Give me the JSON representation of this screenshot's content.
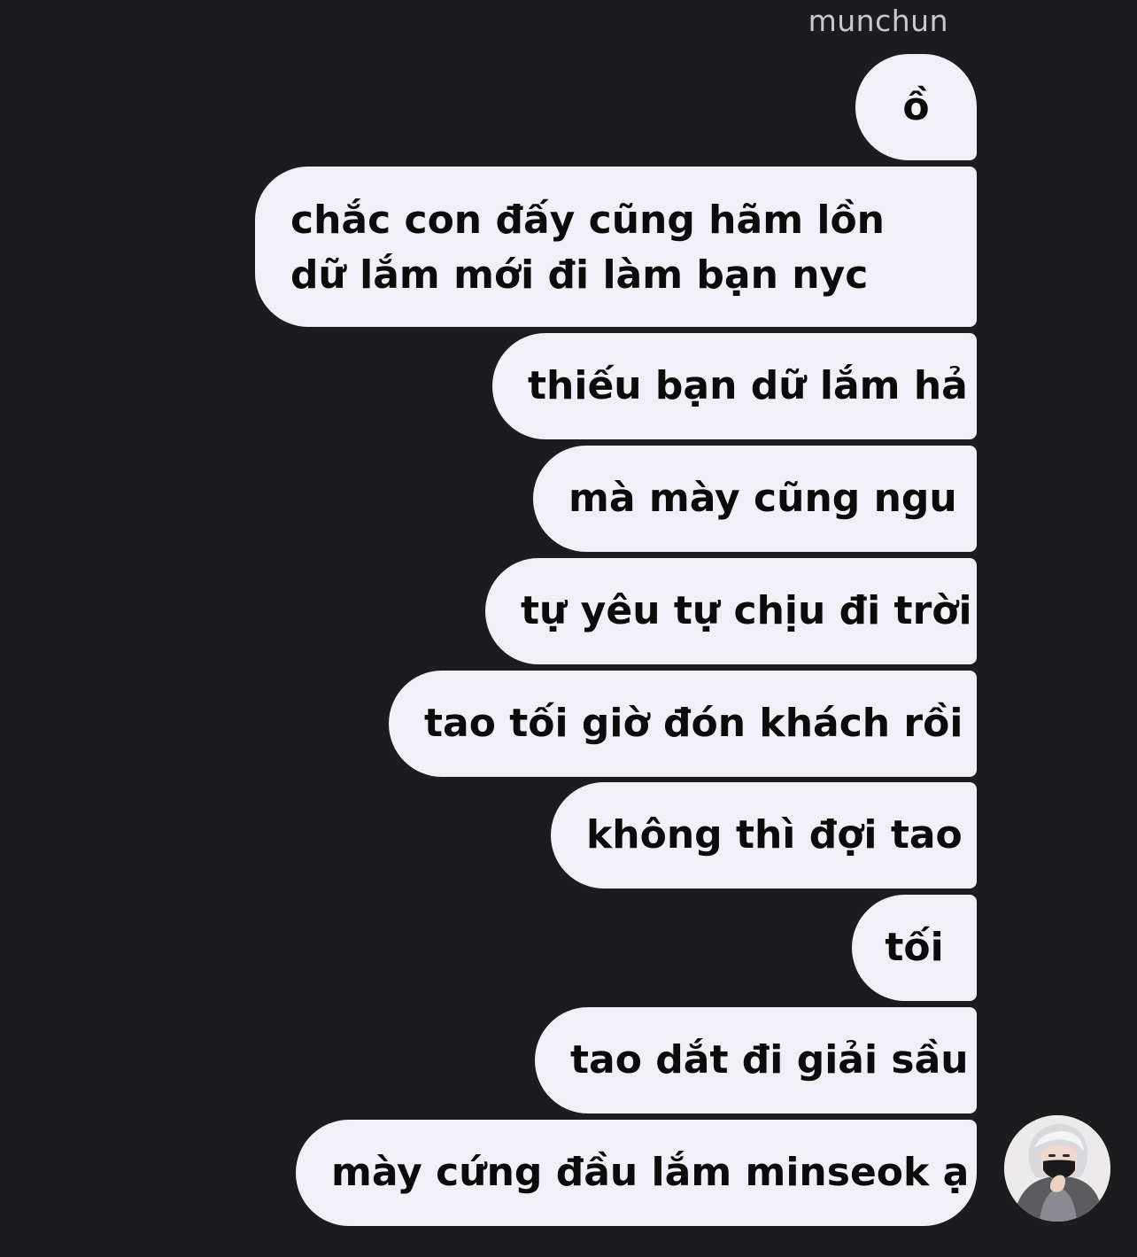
{
  "conversation": {
    "sender_name": "munchun",
    "messages": [
      {
        "text": "ồ"
      },
      {
        "text": "chắc con đấy cũng hãm lồn dữ lắm mới đi làm bạn nyc"
      },
      {
        "text": "thiếu bạn dữ lắm hả"
      },
      {
        "text": "mà mày cũng ngu"
      },
      {
        "text": "tự yêu tự chịu đi trời"
      },
      {
        "text": "tao tối giờ đón khách rồi"
      },
      {
        "text": "không thì đợi tao"
      },
      {
        "text": "tối"
      },
      {
        "text": "tao dắt đi giải sầu"
      },
      {
        "text": "mày cứng đầu lắm minseok ạ"
      }
    ]
  },
  "colors": {
    "background": "#1c1c1e",
    "bubble": "#f1f0f6",
    "bubble_text": "#0b0b0c",
    "name_text": "#c9c9cc"
  }
}
